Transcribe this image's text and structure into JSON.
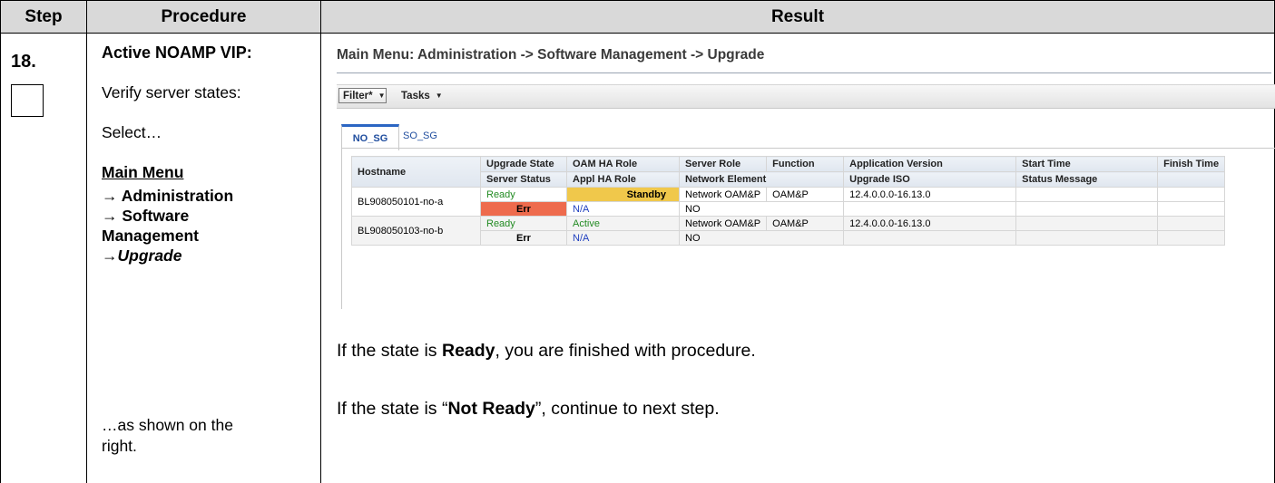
{
  "header": {
    "step": "Step",
    "procedure": "Procedure",
    "result": "Result"
  },
  "step": {
    "number": "18."
  },
  "procedure": {
    "title": "Active NOAMP VIP:",
    "verify": "Verify server states:",
    "select": "Select…",
    "menu": "Main Menu",
    "nav1": "→ Administration",
    "nav2": "→ Software",
    "nav3": "Management",
    "nav4": "→",
    "nav4_em": "Upgrade",
    "as_shown": "…as shown on the",
    "right": "right."
  },
  "screen": {
    "menu_title": "Main Menu: Administration -> Software Management -> Upgrade",
    "filter_label": "Filter*",
    "tasks_label": "Tasks",
    "tabs": [
      "NO_SG",
      "SO_SG"
    ],
    "columns_row1": [
      "Hostname",
      "Upgrade State",
      "OAM HA Role",
      "Server Role",
      "Function",
      "Application Version",
      "Start Time",
      "Finish Time"
    ],
    "columns_row2": [
      "Server Status",
      "Appl HA Role",
      "Network Element",
      "Upgrade ISO",
      "Status Message"
    ],
    "rows": [
      {
        "hostname": "BL908050101-no-a",
        "upgrade_state": "Ready",
        "oam_ha_role": "Standby",
        "server_role": "Network OAM&P",
        "function": "OAM&P",
        "app_version": "12.4.0.0.0-16.13.0",
        "server_status": "Err",
        "appl_ha_role": "N/A",
        "network_element": "NO"
      },
      {
        "hostname": "BL908050103-no-b",
        "upgrade_state": "Ready",
        "oam_ha_role": "Active",
        "server_role": "Network OAM&P",
        "function": "OAM&P",
        "app_version": "12.4.0.0.0-16.13.0",
        "server_status": "Err",
        "appl_ha_role": "N/A",
        "network_element": "NO"
      }
    ]
  },
  "result": {
    "line1_pre": "If the state is ",
    "line1_bold": "Ready",
    "line1_post": ", you are finished with procedure.",
    "line2_pre": "If the state is “",
    "line2_bold": "Not Ready",
    "line2_post": "”, continue to next step."
  },
  "colors": {
    "header_bg": "#d9d9d9",
    "err": "#ee6b4d",
    "standby": "#f0c84b",
    "ready": "#228b22",
    "na": "#1f3fbf"
  }
}
